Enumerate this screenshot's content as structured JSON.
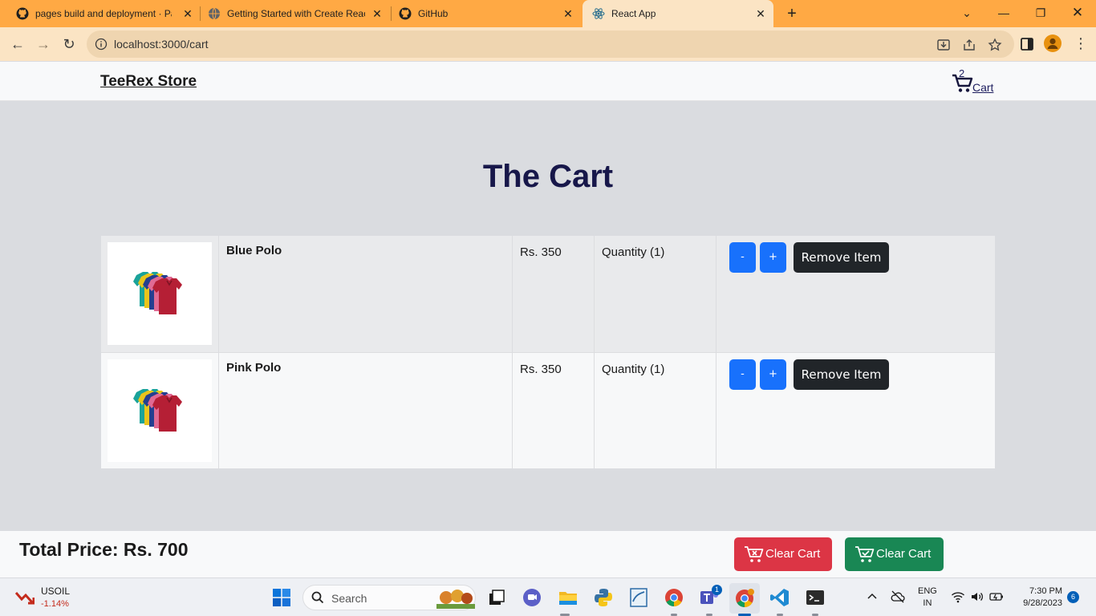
{
  "browser": {
    "tabs": [
      {
        "title": "pages build and deployment · Pages",
        "icon": "github-icon"
      },
      {
        "title": "Getting Started with Create React App",
        "icon": "globe-icon"
      },
      {
        "title": "GitHub",
        "icon": "github-icon"
      },
      {
        "title": "React App",
        "icon": "react-icon",
        "active": true
      }
    ],
    "url": "localhost:3000/cart"
  },
  "navbar": {
    "brand": "TeeRex Store",
    "cart_count": "2",
    "cart_label": "Cart"
  },
  "page": {
    "title": "The Cart",
    "items": [
      {
        "name": "Blue Polo",
        "price": "Rs. 350",
        "quantity": "Quantity (1)",
        "decrement": "-",
        "increment": "+",
        "remove": "Remove Item"
      },
      {
        "name": "Pink Polo",
        "price": "Rs. 350",
        "quantity": "Quantity (1)",
        "decrement": "-",
        "increment": "+",
        "remove": "Remove Item"
      }
    ]
  },
  "footer": {
    "total": "Total Price: Rs. 700",
    "clear_cart": "Clear Cart",
    "checkout": "Clear Cart"
  },
  "taskbar": {
    "stock_name": "USOIL",
    "stock_change": "-1.14%",
    "search_placeholder": "Search",
    "teams_badge": "1",
    "lang_line1": "ENG",
    "lang_line2": "IN",
    "time": "7:30 PM",
    "date": "9/28/2023",
    "notifications": "6"
  },
  "colors": {
    "tab_bar": "#ffa944",
    "toolbar": "#fbe4c4",
    "title": "#17174a",
    "step_button": "#1871fc",
    "remove_button": "#212529",
    "danger": "#dc3545",
    "success": "#198754"
  }
}
